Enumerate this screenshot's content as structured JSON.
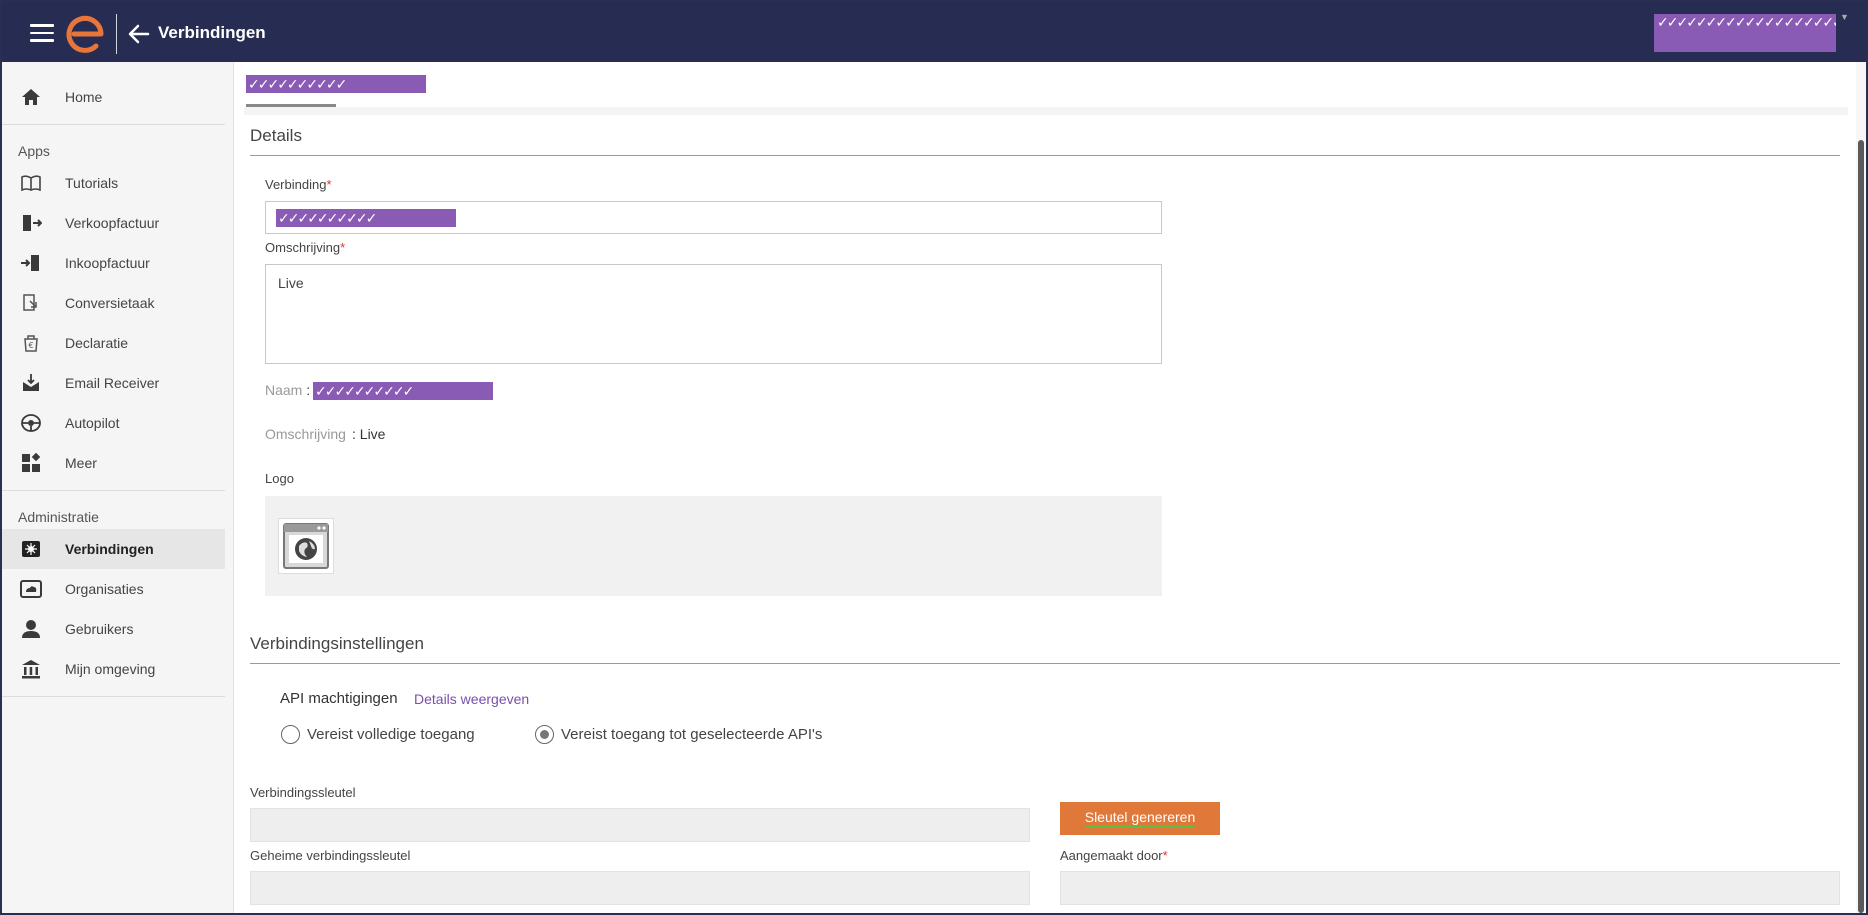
{
  "header": {
    "title": "Verbindingen",
    "user_masked": "✓✓✓✓✓✓✓✓✓✓✓✓✓✓✓✓✓✓✓✓"
  },
  "sidebar": {
    "home": "Home",
    "apps_heading": "Apps",
    "apps": [
      {
        "label": "Tutorials",
        "icon": "book-icon"
      },
      {
        "label": "Verkoopfactuur",
        "icon": "sales-invoice-icon"
      },
      {
        "label": "Inkoopfactuur",
        "icon": "purchase-invoice-icon"
      },
      {
        "label": "Conversietaak",
        "icon": "conversion-icon"
      },
      {
        "label": "Declaratie",
        "icon": "expense-icon"
      },
      {
        "label": "Email Receiver",
        "icon": "email-receiver-icon"
      },
      {
        "label": "Autopilot",
        "icon": "autopilot-icon"
      },
      {
        "label": "Meer",
        "icon": "apps-grid-icon"
      }
    ],
    "admin_heading": "Administratie",
    "admin": [
      {
        "label": "Verbindingen",
        "icon": "connections-icon",
        "active": true
      },
      {
        "label": "Organisaties",
        "icon": "organisations-icon"
      },
      {
        "label": "Gebruikers",
        "icon": "user-icon"
      },
      {
        "label": "Mijn omgeving",
        "icon": "bank-icon"
      }
    ]
  },
  "main": {
    "tab_masked": "✓✓✓✓✓✓✓✓✓✓",
    "details_title": "Details",
    "verbinding_label": "Verbinding",
    "verbinding_masked": "✓✓✓✓✓✓✓✓✓✓",
    "omschrijving_label": "Omschrijving",
    "omschrijving_value": "Live",
    "naam_label": "Naam",
    "naam_masked": "✓✓✓✓✓✓✓✓✓✓",
    "omschrijving_info_label": "Omschrijving",
    "omschrijving_info_value": ": Live",
    "logo_label": "Logo",
    "settings_title": "Verbindingsinstellingen",
    "api_label": "API machtigingen",
    "api_link": "Details weergeven",
    "radio_full": "Vereist volledige toegang",
    "radio_selected": "Vereist toegang tot geselecteerde API's",
    "key_label": "Verbindingssleutel",
    "generate_button": "Sleutel genereren",
    "secret_label": "Geheime verbindingssleutel",
    "created_by_label": "Aangemaakt door",
    "required_mark": "*",
    "colon": " :"
  },
  "colors": {
    "topbar": "#272d52",
    "accent_orange": "#e0783a",
    "redaction_purple": "#8a5bb4",
    "link_purple": "#7a4faa"
  }
}
